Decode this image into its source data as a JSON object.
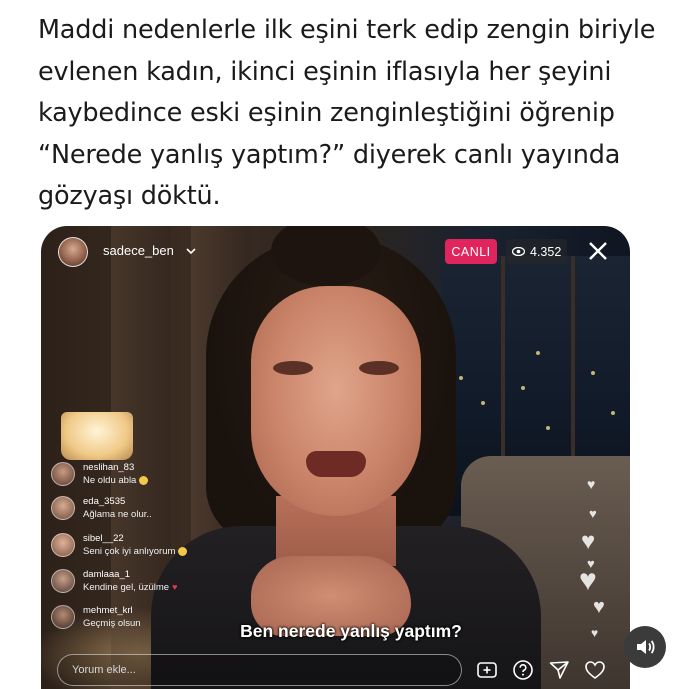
{
  "headline": "Maddi nedenlerle ilk eşini terk edip zengin biriyle evlenen kadın, ikinci eşinin iflasıyla her şeyini kaybedince eski eşinin zenginleştiğini öğrenip “Nerede yanlış yaptım?” diyerek canlı yayında gözyaşı döktü.",
  "live": {
    "username": "sadece_ben",
    "live_badge": "CANLI",
    "viewer_count": "4.352",
    "subtitle": "Ben nerede yanlış yaptım?",
    "comment_placeholder": "Yorum ekle...",
    "comments": [
      {
        "user": "neslihan_83",
        "message": "Ne oldu abla",
        "emoji": "sad-face",
        "emoji_color": "#f2c94c"
      },
      {
        "user": "eda_3535",
        "message": "Ağlama ne olur..",
        "emoji": "",
        "emoji_color": ""
      },
      {
        "user": "sibel__22",
        "message": "Seni çok iyi anlıyorum",
        "emoji": "sad-face",
        "emoji_color": "#f2c94c"
      },
      {
        "user": "damlaaa_1",
        "message": "Kendine gel, üzülme",
        "emoji": "broken-heart",
        "emoji_color": "#e53945"
      },
      {
        "user": "mehmet_krl",
        "message": "Geçmiş olsun",
        "emoji": "",
        "emoji_color": ""
      }
    ],
    "live_color": "#e0245e"
  },
  "icons": [
    "chevron-down-icon",
    "eye-icon",
    "close-icon",
    "heart-icon",
    "add-video-icon",
    "question-icon",
    "send-icon",
    "like-icon",
    "speaker-icon"
  ]
}
